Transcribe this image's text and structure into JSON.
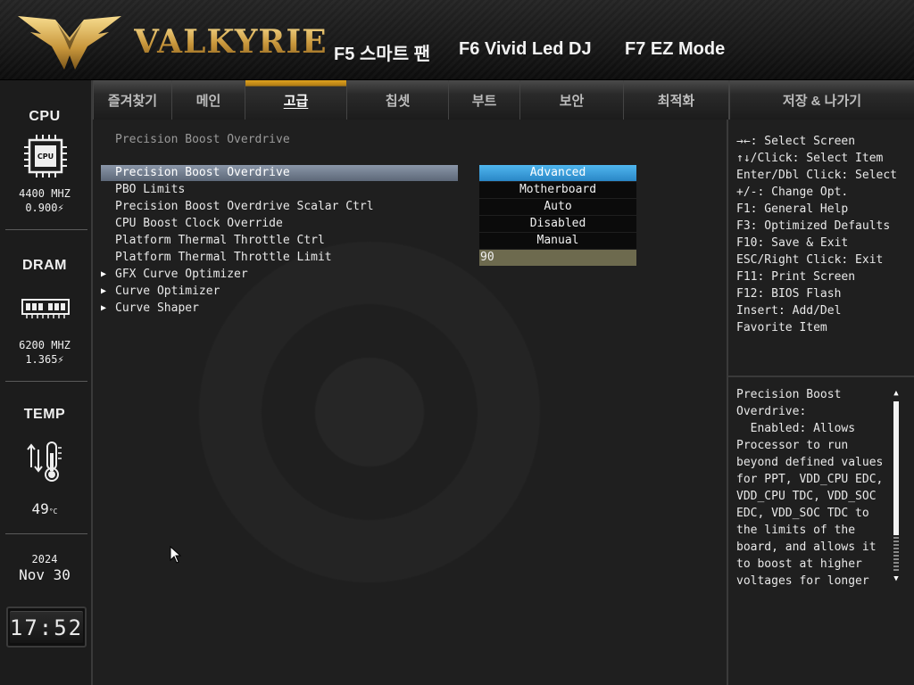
{
  "brand": {
    "name": "VALKYRIE"
  },
  "hotkeys": [
    "F5 스마트 팬",
    "F6 Vivid Led DJ",
    "F7 EZ Mode"
  ],
  "status": {
    "cpu_title": "CPU",
    "cpu_freq": "4400 MHZ",
    "cpu_volt": "0.900",
    "dram_title": "DRAM",
    "dram_freq": "6200 MHZ",
    "dram_volt": "1.365",
    "temp_title": "TEMP",
    "temp_value": "49",
    "temp_unit": "°C",
    "year": "2024",
    "date": "Nov 30",
    "time": "17:52"
  },
  "tabs": [
    {
      "label": "즐겨찾기",
      "active": false
    },
    {
      "label": "메인",
      "active": false
    },
    {
      "label": "고급",
      "active": true
    },
    {
      "label": "칩셋",
      "active": false
    },
    {
      "label": "부트",
      "active": false
    },
    {
      "label": "보안",
      "active": false
    },
    {
      "label": "최적화",
      "active": false
    }
  ],
  "save_tab": "저장 & 나가기",
  "main": {
    "heading": "Precision Boost Overdrive",
    "settings": [
      {
        "label": "Precision Boost Overdrive",
        "value": "Advanced",
        "selected": true
      },
      {
        "label": "PBO Limits",
        "value": "Motherboard"
      },
      {
        "label": "Precision Boost Overdrive Scalar Ctrl",
        "value": "Auto"
      },
      {
        "label": "CPU Boost Clock Override",
        "value": "Disabled"
      },
      {
        "label": "Platform Thermal Throttle Ctrl",
        "value": "Manual"
      },
      {
        "label": "Platform Thermal Throttle Limit",
        "value": "90"
      }
    ],
    "submenus": [
      "GFX Curve Optimizer",
      "Curve Optimizer",
      "Curve Shaper"
    ]
  },
  "help": {
    "keys": [
      "→←: Select Screen",
      "↑↓/Click: Select Item",
      "Enter/Dbl Click: Select",
      "+/-: Change Opt.",
      "F1: General Help",
      "F3: Optimized Defaults",
      "F10: Save & Exit",
      "ESC/Right Click: Exit",
      "F11: Print Screen",
      "F12: BIOS Flash",
      "Insert: Add/Del",
      "Favorite Item"
    ],
    "description": "Precision Boost\nOverdrive:\n  Enabled: Allows\nProcessor to run\nbeyond defined values\nfor PPT, VDD_CPU EDC,\nVDD_CPU TDC, VDD_SOC\nEDC, VDD_SOC TDC to\nthe limits of the\nboard, and allows it\nto boost at higher\nvoltages for longer"
  },
  "colors": {
    "accent_gold": "#e0a21f",
    "selected_value_blue": "#2a87c7",
    "selected_row": "#6f7a8c"
  }
}
